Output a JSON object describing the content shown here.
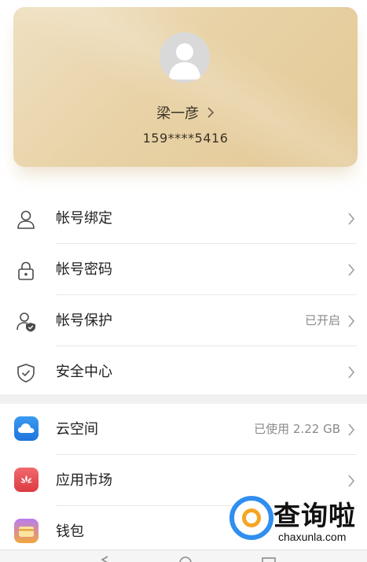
{
  "profile": {
    "name": "梁一彦",
    "phone": "159****5416"
  },
  "account_section": [
    {
      "label": "帐号绑定",
      "value": "",
      "icon": "person-icon"
    },
    {
      "label": "帐号密码",
      "value": "",
      "icon": "lock-icon"
    },
    {
      "label": "帐号保护",
      "value": "已开启",
      "icon": "person-shield-icon"
    },
    {
      "label": "安全中心",
      "value": "",
      "icon": "shield-check-icon"
    }
  ],
  "services_section": [
    {
      "label": "云空间",
      "value": "已使用 2.22 GB",
      "icon": "cloud-app-icon"
    },
    {
      "label": "应用市场",
      "value": "",
      "icon": "appgallery-app-icon"
    },
    {
      "label": "钱包",
      "value": "",
      "icon": "wallet-app-icon"
    }
  ],
  "watermark": {
    "text": "查询啦",
    "domain": "chaxunla.com"
  },
  "colors": {
    "card_gold": "#e8d2a6",
    "cloud_blue": "#2f86e8",
    "appgallery_red": "#e8484d",
    "wallet_gold": "#f1b13c"
  }
}
